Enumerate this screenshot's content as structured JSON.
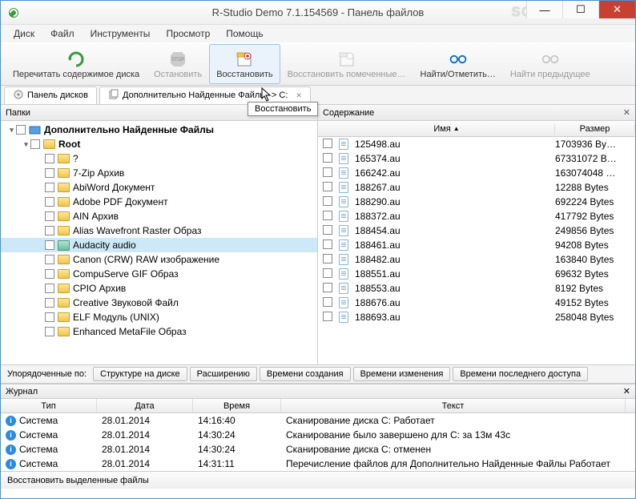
{
  "window": {
    "title": "R-Studio Demo 7.1.154569 - Панель файлов",
    "watermark": "SOFTBUKA"
  },
  "menu": [
    "Диск",
    "Файл",
    "Инструменты",
    "Просмотр",
    "Помощь"
  ],
  "toolbar": [
    {
      "label": "Перечитать содержимое диска",
      "icon": "refresh",
      "color": "#3a9a3a",
      "disabled": false,
      "sel": false
    },
    {
      "label": "Остановить",
      "icon": "stop",
      "color": "#bbb",
      "disabled": true,
      "sel": false
    },
    {
      "label": "Восстановить",
      "icon": "restore",
      "color": "#c06",
      "disabled": false,
      "sel": true
    },
    {
      "label": "Восстановить помеченные…",
      "icon": "restore-marked",
      "color": "#bbb",
      "disabled": true,
      "sel": false
    },
    {
      "label": "Найти/Отметить…",
      "icon": "find",
      "color": "#06c",
      "disabled": false,
      "sel": false
    },
    {
      "label": "Найти предыдущее",
      "icon": "find-prev",
      "color": "#bbb",
      "disabled": true,
      "sel": false
    }
  ],
  "tooltip": "Восстановить",
  "tabs": [
    {
      "label": "Панель дисков",
      "icon": "disk"
    },
    {
      "label": "Дополнительно Найденные Файлы -> C:",
      "icon": "files",
      "close": true
    }
  ],
  "leftPane": {
    "title": "Папки"
  },
  "rightPane": {
    "title": "Содержание",
    "cols": {
      "name": "Имя",
      "size": "Размер"
    }
  },
  "tree": [
    {
      "depth": 0,
      "expand": "▾",
      "chk": true,
      "bold": true,
      "label": "Дополнительно Найденные Файлы",
      "ficon": "system"
    },
    {
      "depth": 1,
      "expand": "▾",
      "chk": true,
      "bold": true,
      "label": "Root"
    },
    {
      "depth": 2,
      "expand": "",
      "chk": true,
      "bold": false,
      "label": "?"
    },
    {
      "depth": 2,
      "expand": "",
      "chk": true,
      "bold": false,
      "label": "7-Zip Архив"
    },
    {
      "depth": 2,
      "expand": "",
      "chk": true,
      "bold": false,
      "label": "AbiWord Документ"
    },
    {
      "depth": 2,
      "expand": "",
      "chk": true,
      "bold": false,
      "label": "Adobe PDF Документ"
    },
    {
      "depth": 2,
      "expand": "",
      "chk": true,
      "bold": false,
      "label": "AIN Архив"
    },
    {
      "depth": 2,
      "expand": "",
      "chk": true,
      "bold": false,
      "label": "Alias Wavefront Raster Образ"
    },
    {
      "depth": 2,
      "expand": "",
      "chk": true,
      "bold": false,
      "label": "Audacity audio",
      "sel": true,
      "special": true
    },
    {
      "depth": 2,
      "expand": "",
      "chk": true,
      "bold": false,
      "label": "Canon (CRW) RAW изображение"
    },
    {
      "depth": 2,
      "expand": "",
      "chk": true,
      "bold": false,
      "label": "CompuServe GIF Образ"
    },
    {
      "depth": 2,
      "expand": "",
      "chk": true,
      "bold": false,
      "label": "CPIO Архив"
    },
    {
      "depth": 2,
      "expand": "",
      "chk": true,
      "bold": false,
      "label": "Creative Звуковой Файл"
    },
    {
      "depth": 2,
      "expand": "",
      "chk": true,
      "bold": false,
      "label": "ELF Модуль (UNIX)"
    },
    {
      "depth": 2,
      "expand": "",
      "chk": true,
      "bold": false,
      "label": "Enhanced MetaFile Образ"
    }
  ],
  "files": [
    {
      "name": "125498.au",
      "size": "1703936 By…"
    },
    {
      "name": "165374.au",
      "size": "67331072 B…"
    },
    {
      "name": "166242.au",
      "size": "163074048 …"
    },
    {
      "name": "188267.au",
      "size": "12288 Bytes"
    },
    {
      "name": "188290.au",
      "size": "692224 Bytes"
    },
    {
      "name": "188372.au",
      "size": "417792 Bytes"
    },
    {
      "name": "188454.au",
      "size": "249856 Bytes"
    },
    {
      "name": "188461.au",
      "size": "94208 Bytes"
    },
    {
      "name": "188482.au",
      "size": "163840 Bytes"
    },
    {
      "name": "188551.au",
      "size": "69632 Bytes"
    },
    {
      "name": "188553.au",
      "size": "8192 Bytes"
    },
    {
      "name": "188676.au",
      "size": "49152 Bytes"
    },
    {
      "name": "188693.au",
      "size": "258048 Bytes"
    }
  ],
  "sort": {
    "label": "Упорядоченные по:",
    "buttons": [
      "Структуре на диске",
      "Расширению",
      "Времени создания",
      "Времени изменения",
      "Времени последнего доступа"
    ]
  },
  "journal": {
    "title": "Журнал",
    "cols": [
      "Тип",
      "Дата",
      "Время",
      "Текст"
    ],
    "rows": [
      {
        "type": "Система",
        "date": "28.01.2014",
        "time": "14:16:40",
        "text": "Сканирование диска C: Работает"
      },
      {
        "type": "Система",
        "date": "28.01.2014",
        "time": "14:30:24",
        "text": "Сканирование было завершено для C: за 13м 43с"
      },
      {
        "type": "Система",
        "date": "28.01.2014",
        "time": "14:30:24",
        "text": "Сканирование диска C: отменен"
      },
      {
        "type": "Система",
        "date": "28.01.2014",
        "time": "14:31:11",
        "text": "Перечисление файлов для Дополнительно Найденные Файлы Работает"
      }
    ]
  },
  "statusbar": "Восстановить выделенные файлы"
}
